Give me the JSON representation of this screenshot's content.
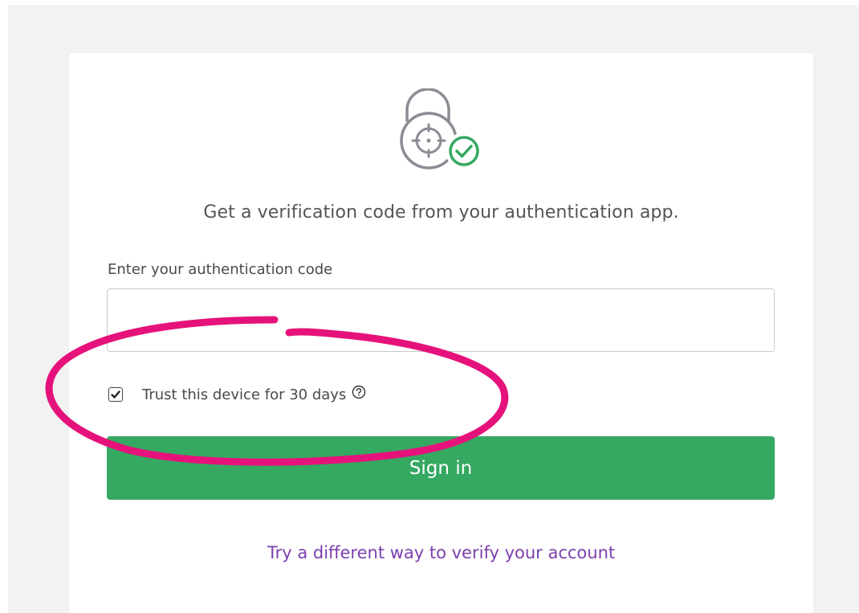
{
  "prompt_text": "Get a verification code from your authentication app.",
  "code_field": {
    "label": "Enter your authentication code",
    "value": "",
    "placeholder": ""
  },
  "trust_device": {
    "label": "Trust this device for 30 days",
    "checked": true
  },
  "sign_in_label": "Sign in",
  "alt_link_label": "Try a different way to verify your account",
  "colors": {
    "accent_green": "#35a862",
    "link_purple": "#7b3fae",
    "annotation_pink": "#e6127b",
    "icon_gray": "#8a8d93"
  },
  "icons": {
    "lock": "lock-with-check-icon",
    "help": "question-circle-icon",
    "check": "checkmark-icon"
  }
}
